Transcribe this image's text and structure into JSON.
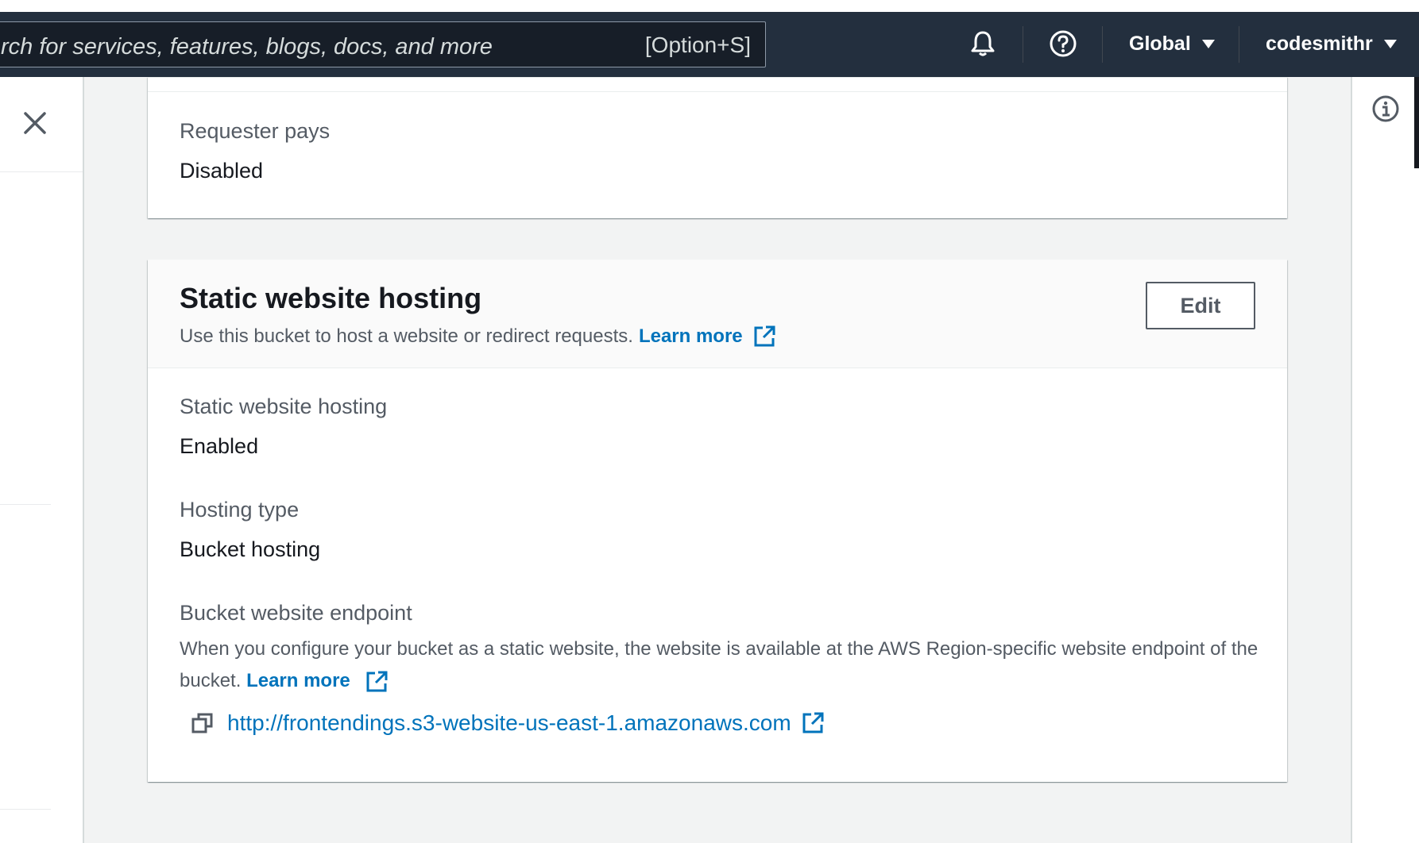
{
  "topbar": {
    "search_placeholder": "rch for services, features, blogs, docs, and more",
    "search_shortcut": "[Option+S]",
    "region_label": "Global",
    "account_label": "codesmithr"
  },
  "requester_pays": {
    "label": "Requester pays",
    "value": "Disabled"
  },
  "static_website_hosting": {
    "title": "Static website hosting",
    "description": "Use this bucket to host a website or redirect requests.",
    "learn_more": "Learn more",
    "edit_label": "Edit",
    "fields": {
      "hosting_label": "Static website hosting",
      "hosting_value": "Enabled",
      "type_label": "Hosting type",
      "type_value": "Bucket hosting",
      "endpoint_label": "Bucket website endpoint",
      "endpoint_description": "When you configure your bucket as a static website, the website is available at the AWS Region-specific website endpoint of the bucket.",
      "endpoint_learn_more": "Learn more",
      "endpoint_url": "http://frontendings.s3-website-us-east-1.amazonaws.com"
    }
  },
  "colors": {
    "nav_bg": "#232f3e",
    "link": "#0073bb",
    "page_bg": "#f2f3f3"
  }
}
